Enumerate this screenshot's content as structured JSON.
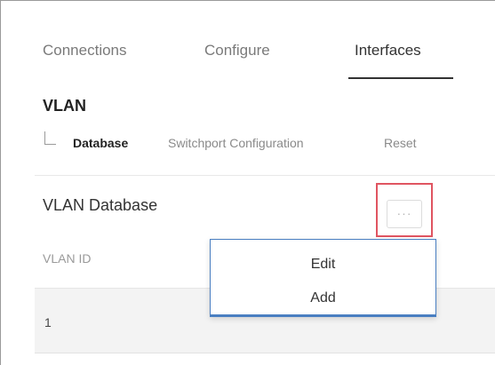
{
  "tabs": {
    "connections": "Connections",
    "configure": "Configure",
    "interfaces": "Interfaces",
    "active": "Interfaces"
  },
  "section": {
    "title": "VLAN"
  },
  "sub_nav": {
    "items": [
      "Database",
      "Switchport Configuration",
      "Reset"
    ],
    "active": "Database"
  },
  "panel": {
    "title": "VLAN Database",
    "more_button_label": "···",
    "more_icon": "ellipsis-icon"
  },
  "table": {
    "headers": [
      "VLAN ID"
    ],
    "rows": [
      [
        "1"
      ]
    ]
  },
  "dropdown_menu": {
    "items": [
      "Edit",
      "Add"
    ]
  },
  "colors": {
    "highlight": "#e05561",
    "menu_border": "#4a7fc1",
    "row_background": "#f3f3f3"
  }
}
